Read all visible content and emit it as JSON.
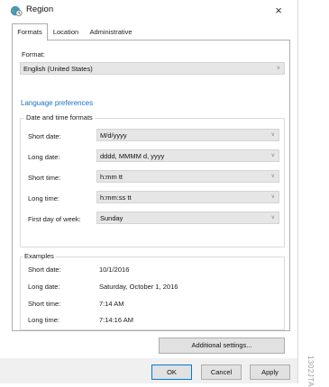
{
  "window": {
    "title": "Region",
    "close_glyph": "×"
  },
  "tabs": [
    {
      "label": "Formats",
      "active": true
    },
    {
      "label": "Location",
      "active": false
    },
    {
      "label": "Administrative",
      "active": false
    }
  ],
  "format": {
    "label": "Format:",
    "value": "English (United States)"
  },
  "language_link": "Language preferences",
  "datetime": {
    "group_title": "Date and time formats",
    "rows": [
      {
        "label": "Short date:",
        "value": "M/d/yyyy"
      },
      {
        "label": "Long date:",
        "value": "dddd, MMMM d, yyyy"
      },
      {
        "label": "Short time:",
        "value": "h:mm tt"
      },
      {
        "label": "Long time:",
        "value": "h:mm:ss tt"
      },
      {
        "label": "First day of week:",
        "value": "Sunday"
      }
    ]
  },
  "examples": {
    "group_title": "Examples",
    "rows": [
      {
        "label": "Short date:",
        "value": "10/1/2016"
      },
      {
        "label": "Long date:",
        "value": "Saturday, October 1, 2016"
      },
      {
        "label": "Short time:",
        "value": "7:14 AM"
      },
      {
        "label": "Long time:",
        "value": "7:14:16 AM"
      }
    ]
  },
  "buttons": {
    "additional": "Additional settings...",
    "ok": "OK",
    "cancel": "Cancel",
    "apply": "Apply"
  },
  "icons": {
    "app": "globe-clock-icon",
    "dropdown": "chevron-down-icon"
  },
  "colors": {
    "link": "#1e6fc4",
    "accent": "#0078d7"
  },
  "side_code": "1302JTA"
}
